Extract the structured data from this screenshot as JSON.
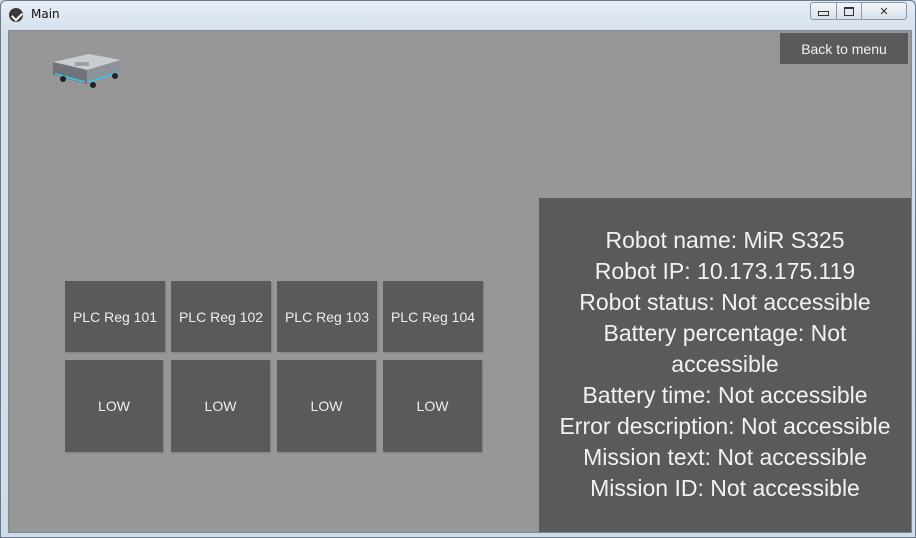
{
  "window": {
    "title": "Main",
    "controls": {
      "minimize": "–",
      "maximize": "□",
      "close": "✕"
    }
  },
  "toolbar": {
    "back_label": "Back to menu"
  },
  "plc_registers": [
    {
      "label": "PLC Reg 101",
      "state": "LOW"
    },
    {
      "label": "PLC Reg 102",
      "state": "LOW"
    },
    {
      "label": "PLC Reg 103",
      "state": "LOW"
    },
    {
      "label": "PLC Reg 104",
      "state": "LOW"
    }
  ],
  "robot_info": {
    "name": "Robot name: MiR S325",
    "ip": "Robot IP: 10.173.175.119",
    "status": "Robot status: Not accessible",
    "battery_percentage": "Battery percentage: Not accessible",
    "battery_time": "Battery time: Not accessible",
    "error_description": "Error description: Not accessible",
    "mission_text": "Mission text: Not accessible",
    "mission_id": "Mission ID: Not accessible"
  },
  "colors": {
    "background": "#979797",
    "panel": "#5a5a5a",
    "text": "#f2f2f2"
  },
  "icons": {
    "app": "app-logo-icon",
    "robot": "mobile-robot-image"
  }
}
